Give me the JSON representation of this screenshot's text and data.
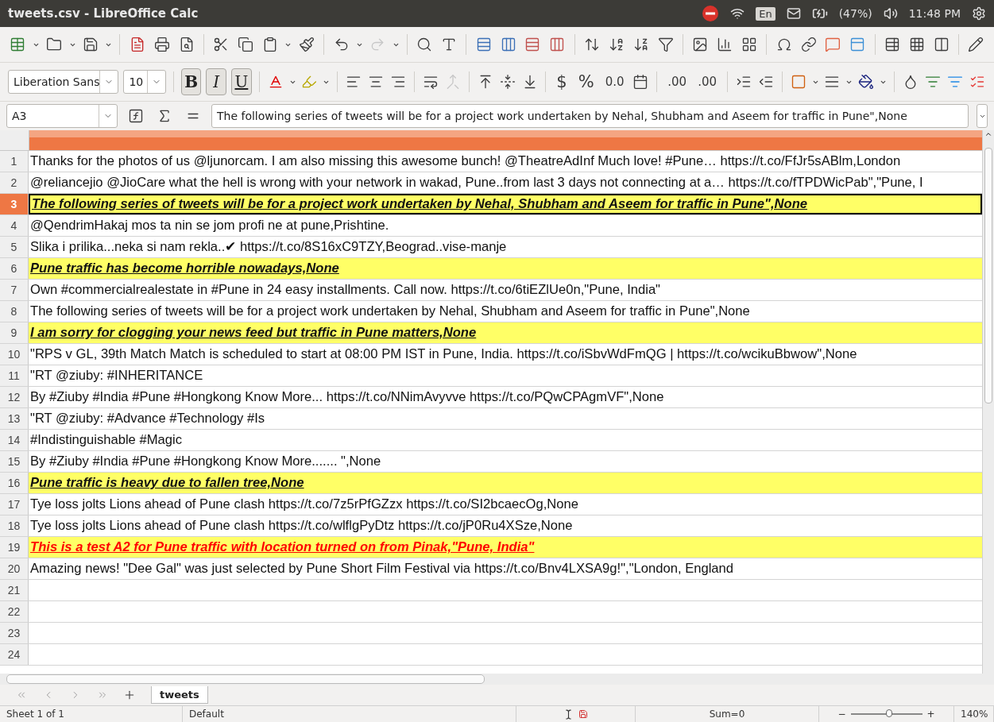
{
  "window": {
    "title": "tweets.csv - LibreOffice Calc"
  },
  "system_tray": {
    "language": "En",
    "battery": "(47%)",
    "time": "11:48 PM"
  },
  "formatting": {
    "font_name": "Liberation Sans",
    "font_size": "10",
    "bold": {
      "label": "B",
      "on": true
    },
    "italic": {
      "label": "I",
      "on": true
    },
    "underline": {
      "label": "U",
      "on": true
    },
    "currency": "$",
    "percent": "%",
    "number": "0.0",
    "add_decimal": ".00",
    "delete_decimal": ".00"
  },
  "formula_bar": {
    "name_box": "A3",
    "content": "The following series of tweets will be for a project work undertaken by Nehal, Shubham and Aseem for traffic in Pune\",None"
  },
  "sheet": {
    "rows": [
      {
        "number": "1",
        "text": "Thanks for the photos of us @ljunorcam. I am also missing this awesome bunch! @TheatreAdInf Much love! #Pune… https://t.co/FfJr5sABlm,London",
        "highlighted": false,
        "selected": false
      },
      {
        "number": "2",
        "text": "@reliancejio @JioCare what the hell is wrong with your network in wakad, Pune..from last 3 days not connecting at a… https://t.co/fTPDWicPab\",\"Pune, I",
        "highlighted": false,
        "selected": false
      },
      {
        "number": "3",
        "text": "The following series of tweets will be for a project work undertaken by Nehal, Shubham and Aseem for traffic in Pune\",None",
        "highlighted": true,
        "selected": true
      },
      {
        "number": "4",
        "text": "@QendrimHakaj mos ta nin se jom profi ne at pune,Prishtine.",
        "highlighted": false,
        "selected": false
      },
      {
        "number": "5",
        "text": "Slika i prilika...neka si nam rekla..✔ https://t.co/8S16xC9TZY,Beograd..vise-manje",
        "highlighted": false,
        "selected": false
      },
      {
        "number": "6",
        "text": "Pune traffic has become horrible nowadays,None",
        "highlighted": true,
        "selected": false
      },
      {
        "number": "7",
        "text": "Own #commercialrealestate in #Pune in 24 easy installments. Call now. https://t.co/6tiEZlUe0n,\"Pune, India\"",
        "highlighted": false,
        "selected": false
      },
      {
        "number": "8",
        "text": "The following series of tweets will be for a project work undertaken by Nehal, Shubham and Aseem for traffic in Pune\",None",
        "highlighted": false,
        "selected": false
      },
      {
        "number": "9",
        "text": "I am sorry for clogging your news feed but traffic in Pune matters,None",
        "highlighted": true,
        "selected": false
      },
      {
        "number": "10",
        "text": "\"RPS v GL, 39th Match Match is scheduled to start at 08:00 PM IST in Pune, India. https://t.co/iSbvWdFmQG | https://t.co/wcikuBbwow\",None",
        "highlighted": false,
        "selected": false
      },
      {
        "number": "11",
        "text": "\"RT @ziuby: #INHERITANCE",
        "highlighted": false,
        "selected": false
      },
      {
        "number": "12",
        "text": "By #Ziuby #India #Pune #Hongkong Know More... https://t.co/NNimAvyvve https://t.co/PQwCPAgmVF\",None",
        "highlighted": false,
        "selected": false
      },
      {
        "number": "13",
        "text": "\"RT @ziuby: #Advance #Technology #Is",
        "highlighted": false,
        "selected": false
      },
      {
        "number": "14",
        "text": "#Indistinguishable #Magic",
        "highlighted": false,
        "selected": false
      },
      {
        "number": "15",
        "text": "By #Ziuby #India #Pune #Hongkong Know More....... \",None",
        "highlighted": false,
        "selected": false
      },
      {
        "number": "16",
        "text": "Pune traffic is heavy due to fallen tree,None",
        "highlighted": true,
        "selected": false
      },
      {
        "number": "17",
        "text": "Tye loss jolts Lions ahead of Pune clash https://t.co/7z5rPfGZzx https://t.co/SI2bcaecOg,None",
        "highlighted": false,
        "selected": false
      },
      {
        "number": "18",
        "text": "Tye loss jolts Lions ahead of Pune clash https://t.co/wlflgPyDtz https://t.co/jP0Ru4XSze,None",
        "highlighted": false,
        "selected": false
      },
      {
        "number": "19",
        "text": "This is a test A2 for Pune traffic with location turned on from Pinak,\"Pune, India\"",
        "highlighted": true,
        "selected": false,
        "color": "#ff0000"
      },
      {
        "number": "20",
        "text": "Amazing news! \"Dee Gal\" was just selected by Pune Short Film Festival via https://t.co/Bnv4LXSA9g!\",\"London, England",
        "highlighted": false,
        "selected": false
      },
      {
        "number": "21",
        "highlighted": false,
        "selected": false
      },
      {
        "number": "22",
        "highlighted": false,
        "selected": false
      },
      {
        "number": "23",
        "highlighted": false,
        "selected": false
      },
      {
        "number": "24",
        "highlighted": false,
        "selected": false
      }
    ]
  },
  "sheet_tabs": [
    {
      "label": "tweets",
      "selected": true
    }
  ],
  "status_bar": {
    "sheet": "Sheet 1 of 1",
    "page_style": "Default",
    "sum": "Sum=0",
    "zoom_out": "−",
    "zoom_in": "+",
    "zoom": {
      "level": 0.55,
      "reading": "140%"
    }
  }
}
